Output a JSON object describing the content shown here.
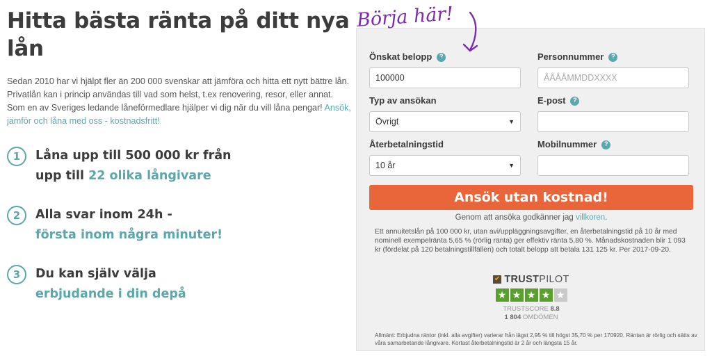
{
  "headline": "Hitta bästa ränta på ditt nya lån",
  "intro": {
    "text": "Sedan 2010 har vi hjälpt fler än 200 000 svenskar att jämföra och hitta ett nytt bättre lån. Privatlån kan i princip användas till vad som helst, t.ex renovering, resor, eller annat. Som en av Sveriges ledande låneförmedlare hjälper vi dig när du vill låna pengar!",
    "link": "Ansök, jämför och låna med oss - kostnadsfritt!"
  },
  "steps": [
    {
      "num": "1",
      "line1": "Låna upp till 500 000 kr från",
      "line2_prefix": "upp till ",
      "line2_highlight": "22 olika långivare"
    },
    {
      "num": "2",
      "line1": "Alla svar inom 24h -",
      "line2_highlight": "första inom några minuter!"
    },
    {
      "num": "3",
      "line1": "Du kan själv välja",
      "line2_highlight": "erbjudande i din depå"
    }
  ],
  "annotation": "Börja här!",
  "form": {
    "amount": {
      "label": "Önskat belopp",
      "value": "100000"
    },
    "ssn": {
      "label": "Personnummer",
      "placeholder": "ÅÅÅÅMMDDXXXX"
    },
    "type": {
      "label": "Typ av ansökan",
      "value": "Övrigt"
    },
    "email": {
      "label": "E-post",
      "value": ""
    },
    "term": {
      "label": "Återbetalningstid",
      "value": "10 år"
    },
    "mobile": {
      "label": "Mobilnummer",
      "value": ""
    },
    "help_glyph": "?",
    "submit": "Ansök utan kostnad!",
    "accept_prefix": "Genom att ansöka godkänner jag ",
    "accept_link": "villkoren",
    "accept_suffix": ".",
    "example": "Ett annuitetslån på 100 000 kr, utan avi/uppläggningsavgifter, en återbetalningstid på 10 år med nominell exempelränta 5,65 % (rörlig ränta) ger effektiv ränta 5,80 %. Månadskostnaden blir 1 093 kr (fördelat på 120 betalningstillfällen) och totalt belopp att betala 131 125 kr. Per 2017-09-20.",
    "footer": "Allmänt: Erbjudna räntor (inkl. alla avgifter) varierar från lägst 2,95 % till högst 35,70 % per 170920. Räntan är rörlig och sätts av våra samarbetande långivare. Kortast återbetalningstid är 2 år och längsta 15 år."
  },
  "trustpilot": {
    "brand_trust": "TRUST",
    "brand_pilot": "PILOT",
    "stars_filled": 4,
    "stars_total": 5,
    "score_label": "TRUSTSCORE",
    "score": "8.8",
    "reviews_count": "1 804",
    "reviews_label": "OMDÖMEN"
  },
  "colors": {
    "accent": "#5aa7ad",
    "cta": "#e8663a",
    "annotation": "#7a2bb0",
    "star": "#5aa02c"
  }
}
